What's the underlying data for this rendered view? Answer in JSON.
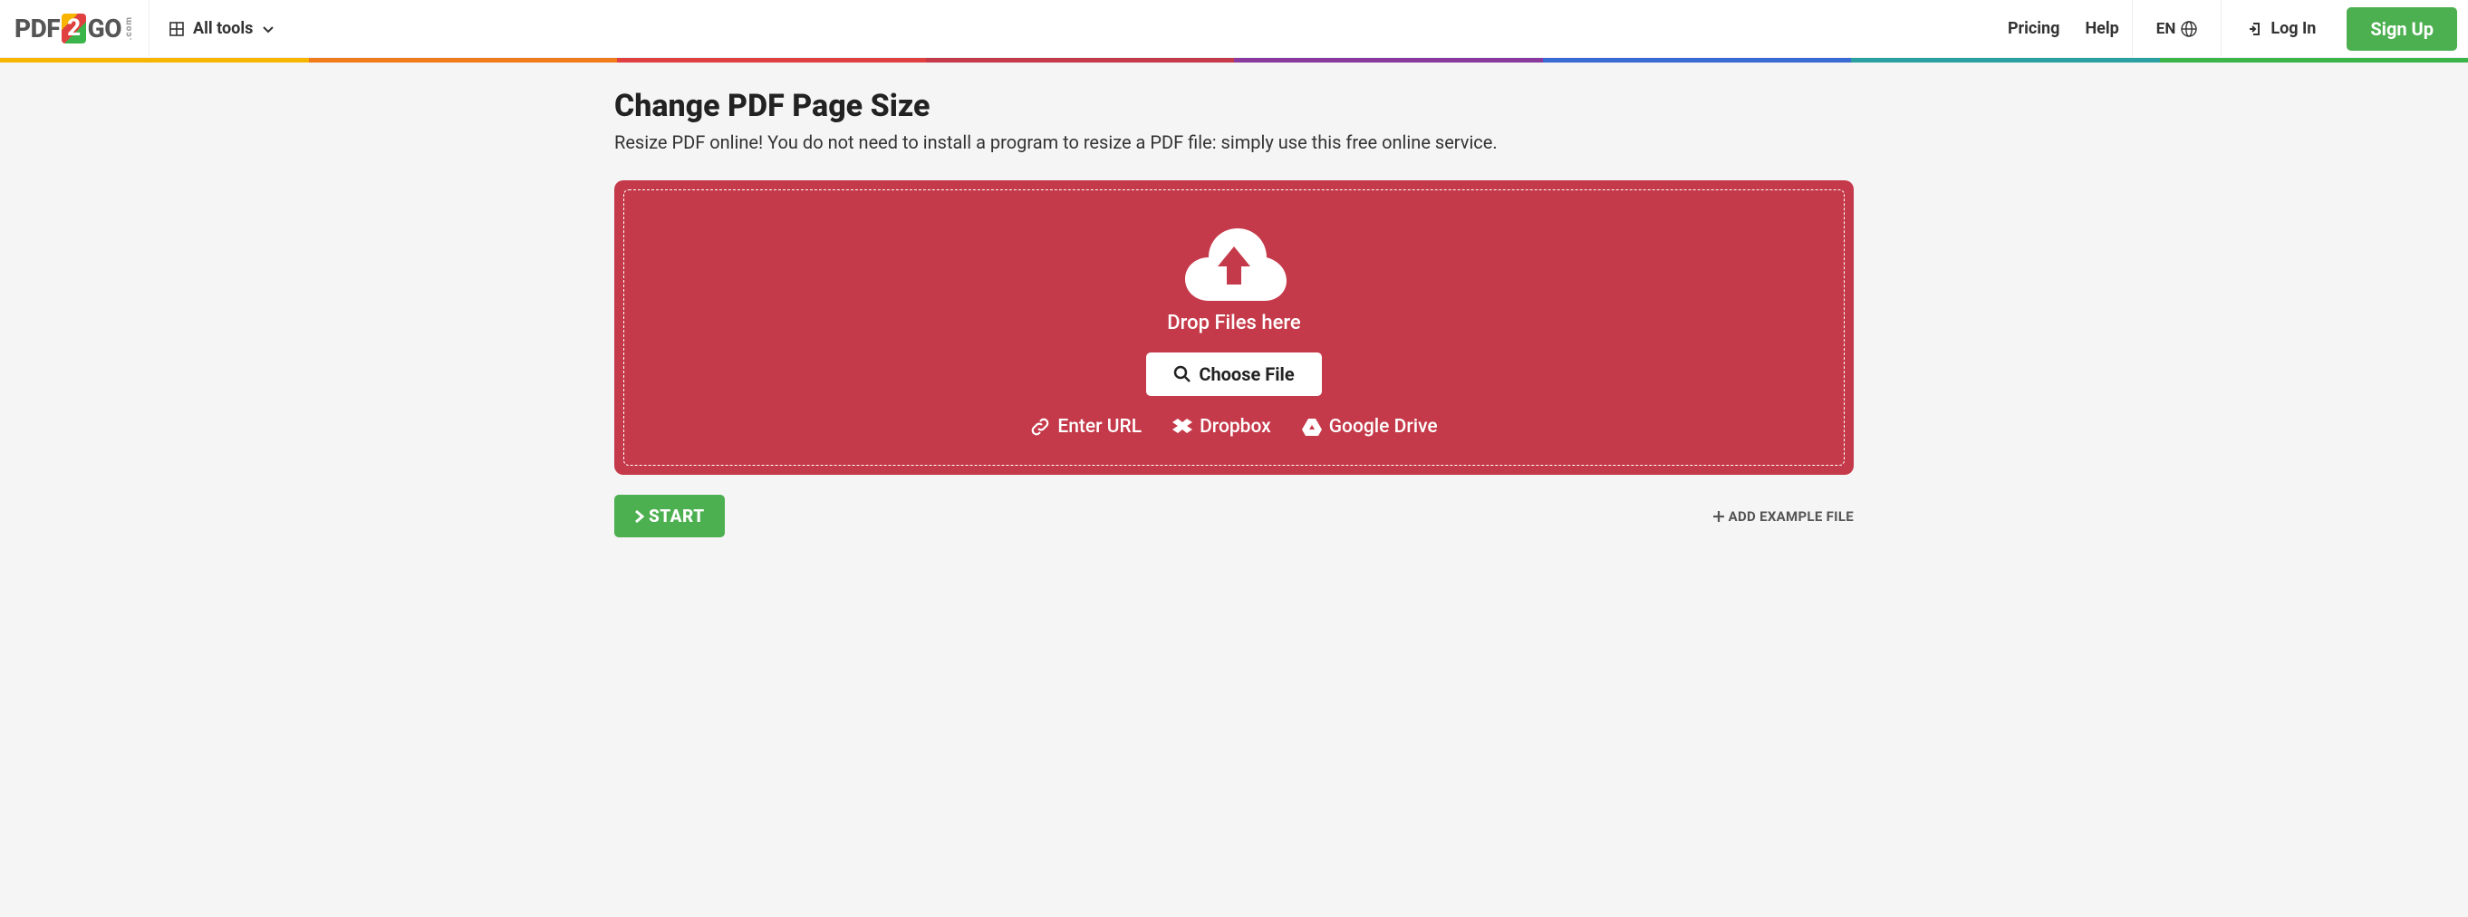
{
  "header": {
    "logo": {
      "pdf": "PDF",
      "two": "2",
      "go": "GO",
      "com": ".com"
    },
    "all_tools": "All tools",
    "nav": {
      "pricing": "Pricing",
      "help": "Help"
    },
    "lang": "EN",
    "login": "Log In",
    "signup": "Sign Up"
  },
  "rainbow_colors": [
    "#f7b500",
    "#f07b1a",
    "#e04040",
    "#c53a4a",
    "#8a3a9e",
    "#3a6ad4",
    "#2aa0a0",
    "#3bb54a"
  ],
  "page": {
    "title": "Change PDF Page Size",
    "subtitle": "Resize PDF online! You do not need to install a program to resize a PDF file: simply use this free online service."
  },
  "dropzone": {
    "drop_text": "Drop Files here",
    "choose_file": "Choose File",
    "sources": {
      "url": "Enter URL",
      "dropbox": "Dropbox",
      "gdrive": "Google Drive"
    }
  },
  "actions": {
    "start": "START",
    "add_example": "ADD EXAMPLE FILE"
  }
}
